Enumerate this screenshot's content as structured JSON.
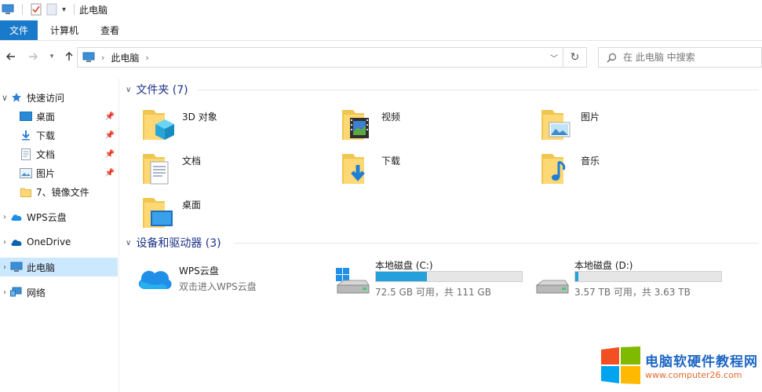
{
  "titlebar": {
    "title": "此电脑"
  },
  "ribbon": {
    "tabs": [
      "文件",
      "计算机",
      "查看"
    ]
  },
  "address": {
    "crumb": "此电脑"
  },
  "search": {
    "placeholder": "在 此电脑 中搜索"
  },
  "sidebar": {
    "quick_access": "快速访问",
    "pinned": [
      "桌面",
      "下载",
      "文档",
      "图片"
    ],
    "recent": "7、镜像文件",
    "wps": "WPS云盘",
    "onedrive": "OneDrive",
    "thispc": "此电脑",
    "network": "网络"
  },
  "folders": {
    "header": "文件夹 (7)",
    "items": [
      "3D 对象",
      "视频",
      "图片",
      "文档",
      "下载",
      "音乐",
      "桌面"
    ]
  },
  "devices": {
    "header": "设备和驱动器 (3)",
    "wps": {
      "name": "WPS云盘",
      "sub": "双击进入WPS云盘"
    },
    "drives": [
      {
        "name": "本地磁盘 (C:)",
        "sub": "72.5 GB 可用，共 111 GB",
        "used_fraction": 0.35
      },
      {
        "name": "本地磁盘 (D:)",
        "sub": "3.57 TB 可用，共 3.63 TB",
        "used_fraction": 0.02
      }
    ]
  },
  "watermark": {
    "title": "电脑软硬件教程网",
    "url": "www.computer26.com"
  },
  "colors": {
    "accent": "#1979ca",
    "selected": "#cce8ff",
    "section": "#1e3287",
    "bar_fill": "#26a0da"
  }
}
